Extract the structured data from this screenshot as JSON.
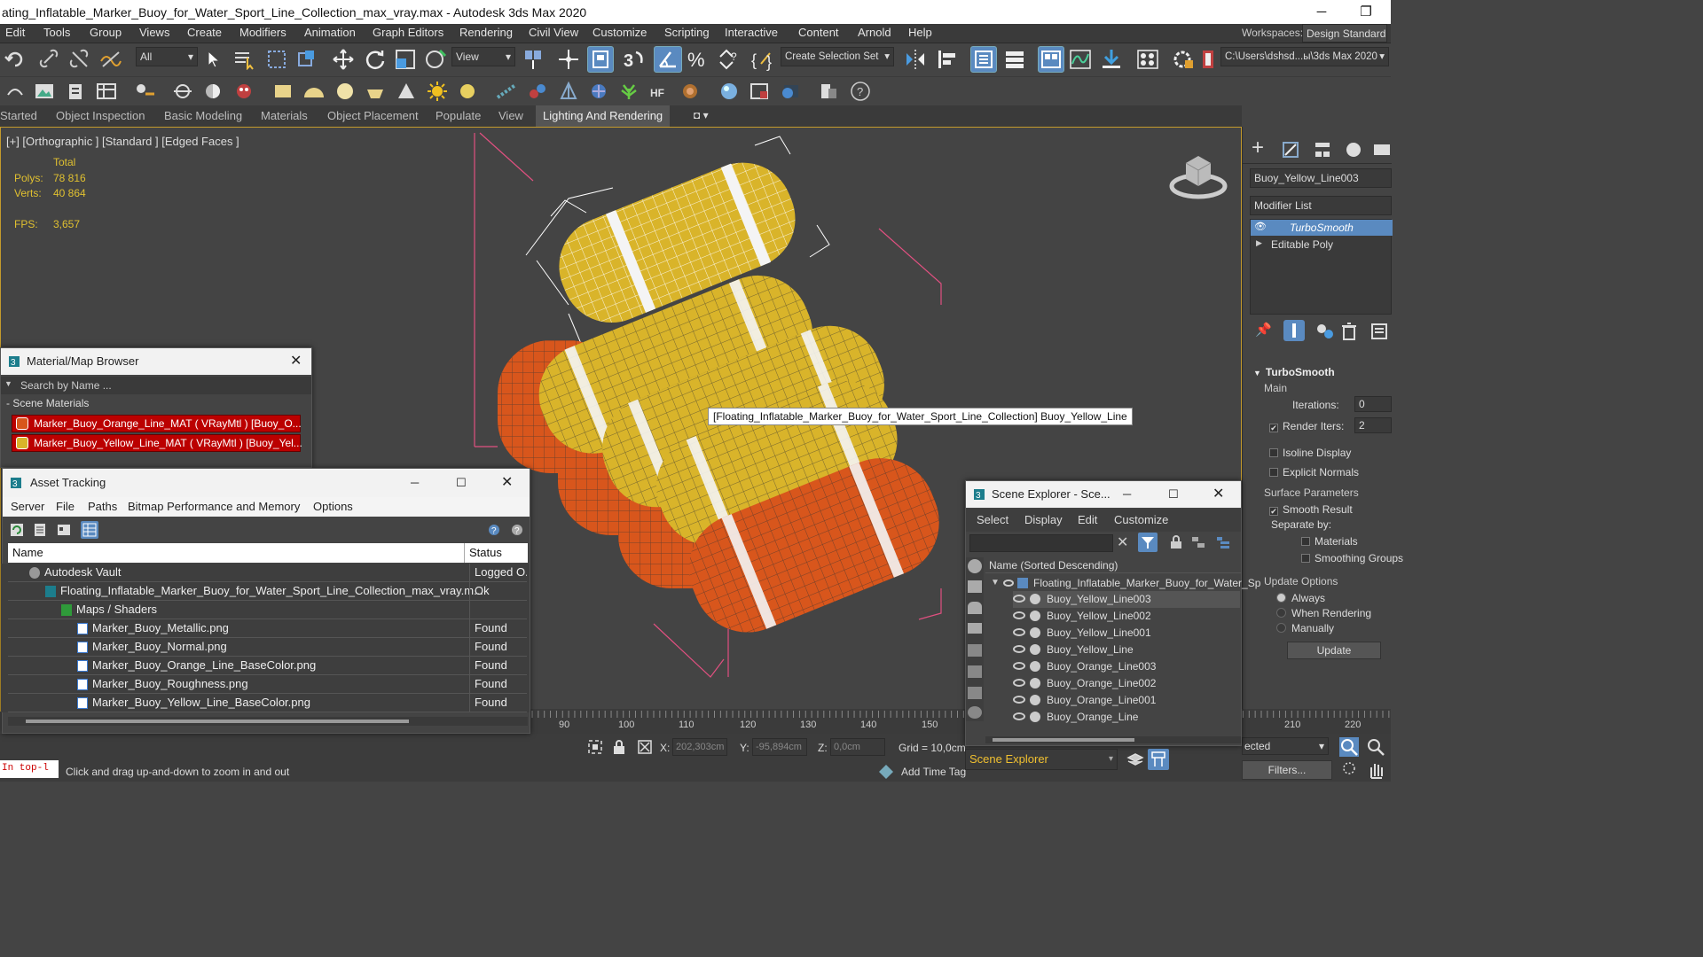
{
  "window": {
    "title": "ating_Inflatable_Marker_Buoy_for_Water_Sport_Line_Collection_max_vray.max - Autodesk 3ds Max 2020"
  },
  "menu": [
    "Edit",
    "Tools",
    "Group",
    "Views",
    "Create",
    "Modifiers",
    "Animation",
    "Graph Editors",
    "Rendering",
    "Civil View",
    "Customize",
    "Scripting",
    "Interactive",
    "Content",
    "Arnold",
    "Help"
  ],
  "workspace": {
    "label": "Workspaces:",
    "value": "Design Standard"
  },
  "toolbar": {
    "filter": "All",
    "ref_coord": "View",
    "selection_set": "Create Selection Set",
    "project_path": "C:\\Users\\dshsd...ы\\3ds Max 2020"
  },
  "ribbon_tabs": [
    "Started",
    "Object Inspection",
    "Basic Modeling",
    "Materials",
    "Object Placement",
    "Populate",
    "View",
    "Lighting And Rendering"
  ],
  "viewport": {
    "label": "[+] [Orthographic ] [Standard ] [Edged Faces ]",
    "stats_header": "Total",
    "polys_label": "Polys:",
    "polys": "78 816",
    "verts_label": "Verts:",
    "verts": "40 864",
    "fps_label": "FPS:",
    "fps": "3,657",
    "tooltip": "[Floating_Inflatable_Marker_Buoy_for_Water_Sport_Line_Collection] Buoy_Yellow_Line",
    "colors": {
      "yellow": "#d9b42a",
      "orange": "#d8561c",
      "stripe": "#f4f4f4"
    }
  },
  "material_browser": {
    "title": "Material/Map Browser",
    "search_placeholder": "Search by Name ...",
    "section": "- Scene Materials",
    "items": [
      {
        "name": "Marker_Buoy_Orange_Line_MAT  ( VRayMtl )  [Buoy_O...",
        "color": "#d8561c"
      },
      {
        "name": "Marker_Buoy_Yellow_Line_MAT  ( VRayMtl )  [Buoy_Yel...",
        "color": "#d9b42a"
      }
    ]
  },
  "asset_tracking": {
    "title": "Asset Tracking",
    "menu": [
      "Server",
      "File",
      "Paths",
      "Bitmap Performance and Memory",
      "Options"
    ],
    "col_name": "Name",
    "col_status": "Status",
    "rows": [
      {
        "name": "Autodesk Vault",
        "status": "Logged O...",
        "indent": 0,
        "icon": "vault"
      },
      {
        "name": "Floating_Inflatable_Marker_Buoy_for_Water_Sport_Line_Collection_max_vray.m...",
        "status": "Ok",
        "indent": 1,
        "icon": "max"
      },
      {
        "name": "Maps / Shaders",
        "status": "",
        "indent": 2,
        "icon": "maps"
      },
      {
        "name": "Marker_Buoy_Metallic.png",
        "status": "Found",
        "indent": 3,
        "icon": "file"
      },
      {
        "name": "Marker_Buoy_Normal.png",
        "status": "Found",
        "indent": 3,
        "icon": "file"
      },
      {
        "name": "Marker_Buoy_Orange_Line_BaseColor.png",
        "status": "Found",
        "indent": 3,
        "icon": "file"
      },
      {
        "name": "Marker_Buoy_Roughness.png",
        "status": "Found",
        "indent": 3,
        "icon": "file"
      },
      {
        "name": "Marker_Buoy_Yellow_Line_BaseColor.png",
        "status": "Found",
        "indent": 3,
        "icon": "file"
      }
    ]
  },
  "scene_explorer": {
    "title": "Scene Explorer - Sce...",
    "menu": [
      "Select",
      "Display",
      "Edit",
      "Customize"
    ],
    "col": "Name (Sorted Descending)",
    "root": "Floating_Inflatable_Marker_Buoy_for_Water_Sp",
    "items": [
      "Buoy_Yellow_Line003",
      "Buoy_Yellow_Line002",
      "Buoy_Yellow_Line001",
      "Buoy_Yellow_Line",
      "Buoy_Orange_Line003",
      "Buoy_Orange_Line002",
      "Buoy_Orange_Line001",
      "Buoy_Orange_Line"
    ],
    "footer": "Scene Explorer"
  },
  "command_panel": {
    "object_name": "Buoy_Yellow_Line003",
    "modifier_list": "Modifier List",
    "stack": [
      "TurboSmooth",
      "Editable Poly"
    ],
    "rollout": "TurboSmooth",
    "main": "Main",
    "iterations_label": "Iterations:",
    "iterations": "0",
    "render_iters_label": "Render Iters:",
    "render_iters": "2",
    "isoline": "Isoline Display",
    "explicit": "Explicit Normals",
    "surface": "Surface Parameters",
    "smooth_result": "Smooth Result",
    "separate_by": "Separate by:",
    "materials": "Materials",
    "smoothing": "Smoothing Groups",
    "update_options": "Update Options",
    "always": "Always",
    "when_rendering": "When Rendering",
    "manually": "Manually",
    "update_btn": "Update"
  },
  "timeline": {
    "ticks": [
      "90",
      "100",
      "110",
      "120",
      "130",
      "140",
      "150",
      "210",
      "220"
    ]
  },
  "status": {
    "mini": "In top-l",
    "prompt": "Click and drag up-and-down to zoom in and out",
    "x_label": "X:",
    "x": "202,303cm",
    "y_label": "Y:",
    "y": "-95,894cm",
    "z_label": "Z:",
    "z": "0,0cm",
    "grid": "Grid = 10,0cm",
    "add_time_tag": "Add Time Tag",
    "selected": "ected",
    "filters": "Filters..."
  }
}
